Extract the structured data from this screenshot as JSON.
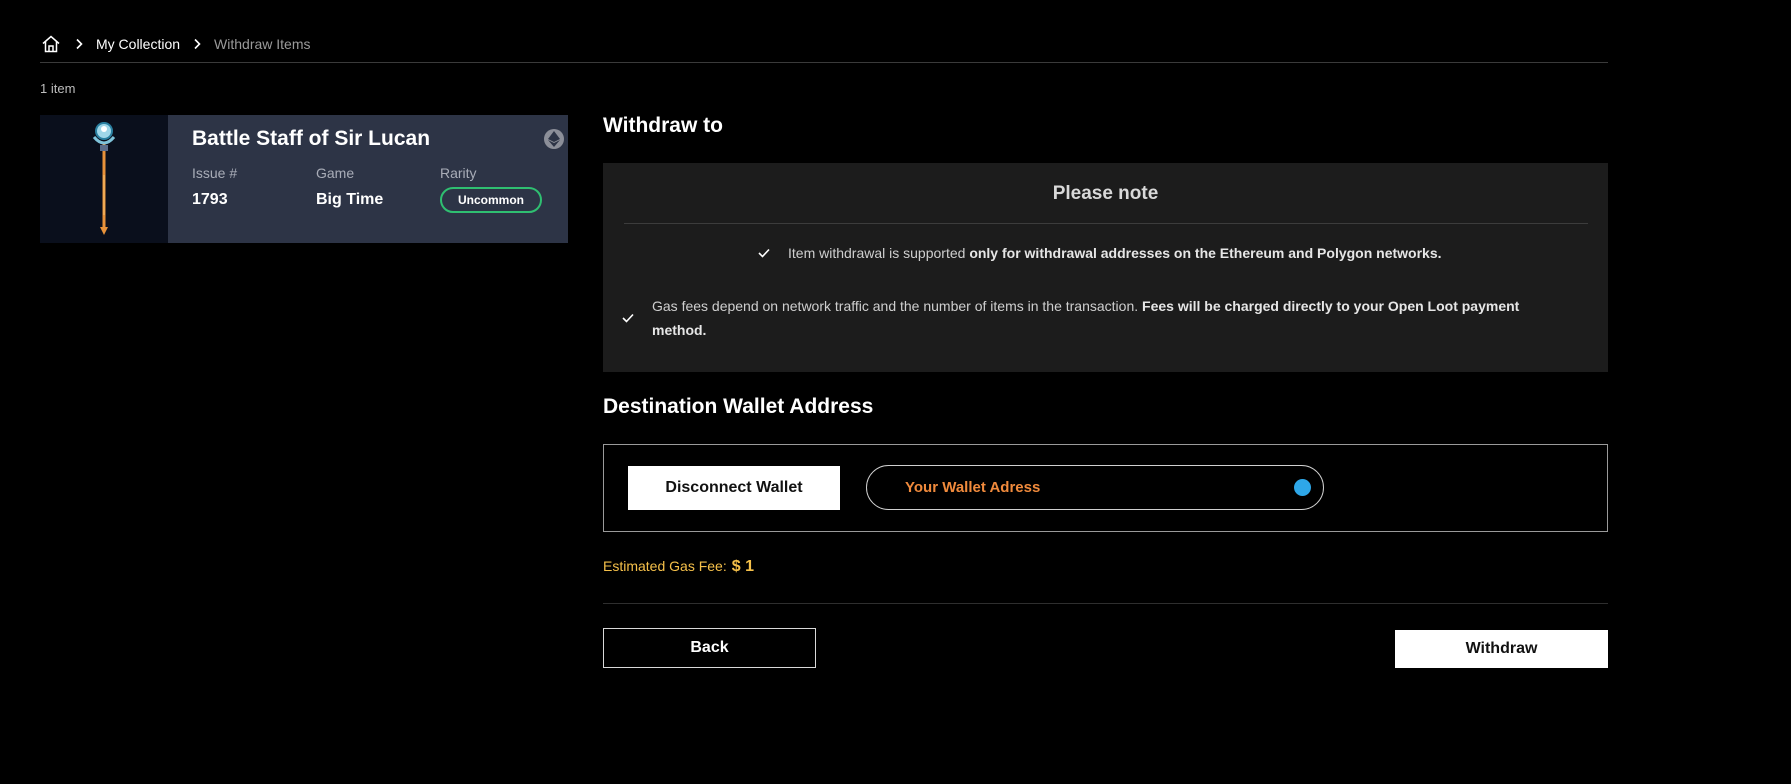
{
  "breadcrumb": {
    "home_icon": "home-icon",
    "items": [
      "My Collection",
      "Withdraw Items"
    ]
  },
  "item_count": "1 item",
  "item": {
    "title": "Battle Staff of Sir Lucan",
    "chain_icon": "ethereum-icon",
    "issue_label": "Issue #",
    "issue_value": "1793",
    "game_label": "Game",
    "game_value": "Big Time",
    "rarity_label": "Rarity",
    "rarity_value": "Uncommon",
    "rarity_color": "#2fbf71"
  },
  "withdraw": {
    "heading": "Withdraw to",
    "note": {
      "title": "Please note",
      "line1_text": "Item withdrawal is supported ",
      "line1_bold": "only for withdrawal addresses on the Ethereum and Polygon networks.",
      "line2_text": "Gas fees depend on network traffic and the number of items in the transaction. ",
      "line2_bold": "Fees will be charged directly to your Open Loot payment method."
    },
    "destination_heading": "Destination Wallet Address",
    "disconnect_label": "Disconnect Wallet",
    "wallet_placeholder": "Your Wallet Adress",
    "wallet_text_color": "#f08a3c",
    "wallet_status_color": "#2ea7e8",
    "gas_fee_label": "Estimated Gas Fee:",
    "gas_fee_value": "$ 1",
    "gas_fee_color": "#f5c04a",
    "back_label": "Back",
    "withdraw_label": "Withdraw"
  }
}
